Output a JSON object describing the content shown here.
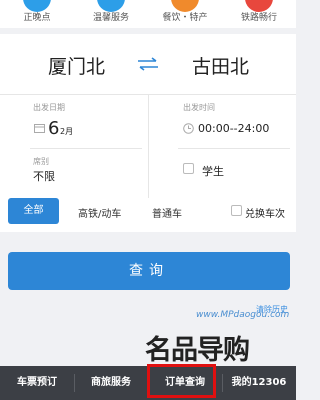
{
  "top_icons": [
    {
      "label": "正晚点",
      "icon": "clock-status-icon",
      "color": "#2d9ee8"
    },
    {
      "label": "温馨服务",
      "icon": "service-icon",
      "color": "#2d9ee8"
    },
    {
      "label": "餐饮・特产",
      "icon": "food-icon",
      "color": "#f08a2c"
    },
    {
      "label": "铁路畅行",
      "icon": "railway-icon",
      "color": "#e8473d"
    }
  ],
  "route": {
    "from": "厦门北",
    "to": "古田北",
    "swap_icon": "swap-arrows-icon"
  },
  "departure_date": {
    "label": "出发日期",
    "day": "6",
    "month": "2月"
  },
  "departure_time": {
    "label": "出发时间",
    "range": "00:00--24:00"
  },
  "seat": {
    "label": "席别",
    "value": "不限"
  },
  "student": {
    "label": "学生",
    "checked": false
  },
  "train_types": {
    "all": "全部",
    "gaotie": "高铁/动车",
    "putong": "普通车",
    "selected": "全部"
  },
  "transfer": {
    "label": "兑换车次",
    "checked": false
  },
  "search": {
    "label": "查询"
  },
  "clear_history": "清除历史",
  "watermark": {
    "url": "www.MPdaogou.com",
    "text": "名品导购"
  },
  "bottom_nav": {
    "items": [
      "车票预订",
      "商旅服务",
      "订单查询",
      "我的12306"
    ],
    "highlighted": "订单查询"
  },
  "colors": {
    "accent": "#2d86d6",
    "nav_bg": "#3c3f45",
    "highlight": "#e01010"
  }
}
